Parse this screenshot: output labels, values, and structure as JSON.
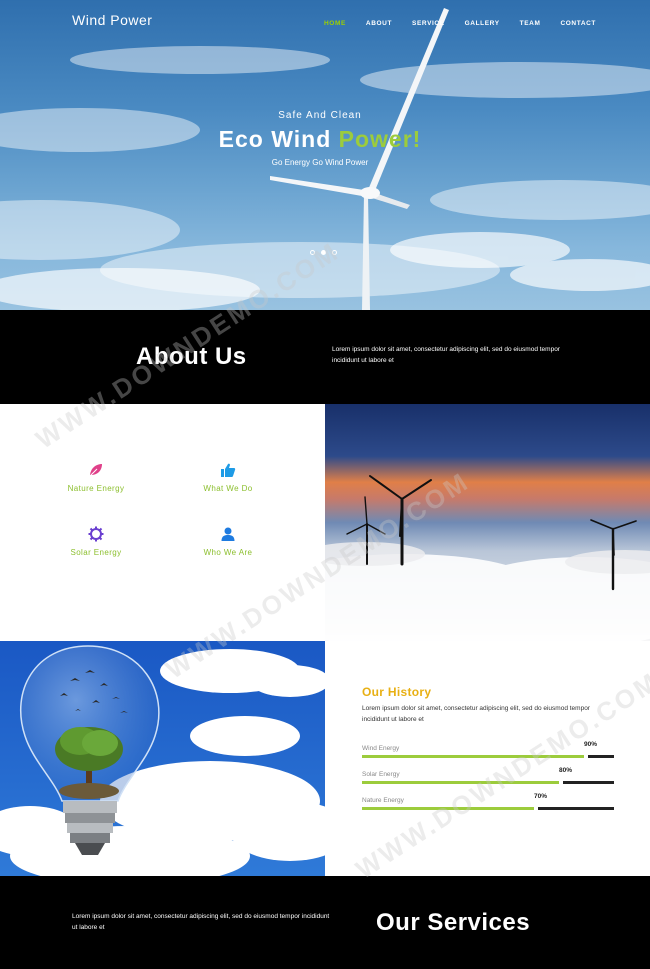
{
  "header": {
    "brand": "Wind Power",
    "nav": [
      {
        "label": "HOME",
        "active": true
      },
      {
        "label": "ABOUT",
        "active": false
      },
      {
        "label": "SERVICE",
        "active": false
      },
      {
        "label": "GALLERY",
        "active": false
      },
      {
        "label": "TEAM",
        "active": false
      },
      {
        "label": "CONTACT",
        "active": false
      }
    ]
  },
  "hero": {
    "subtitle": "Safe And Clean",
    "title_part1": "Eco Wind ",
    "title_accent": "Power!",
    "tagline": "Go Energy Go Wind Power",
    "slides": 3,
    "active_slide": 2
  },
  "about": {
    "title": "About Us",
    "text": "Lorem ipsum dolor sit amet, consectetur adipiscing elit, sed do eiusmod tempor incididunt ut labore et"
  },
  "features": [
    {
      "label": "Nature Energy",
      "icon": "leaf-icon"
    },
    {
      "label": "What We Do",
      "icon": "thumbs-up-icon"
    },
    {
      "label": "Solar Energy",
      "icon": "gear-icon"
    },
    {
      "label": "Who We Are",
      "icon": "user-icon"
    }
  ],
  "history": {
    "title": "Our History",
    "text": "Lorem ipsum dolor sit amet, consectetur adipiscing elit, sed do eiusmod tempor incididunt ut labore et",
    "skills": [
      {
        "name": "Wind Energy",
        "percent": "90%",
        "value": 90
      },
      {
        "name": "Solar Energy",
        "percent": "80%",
        "value": 80
      },
      {
        "name": "Nature Energy",
        "percent": "70%",
        "value": 70
      }
    ]
  },
  "services": {
    "title": "Our Services",
    "text": "Lorem ipsum dolor sit amet, consectetur adipiscing elit, sed do eiusmod tempor incididunt ut labore et"
  },
  "watermark": "WWW.DOWNDEMO.COM",
  "colors": {
    "accent_green": "#9ccc3c",
    "history_title": "#e8b014",
    "feature_label": "#8cbf2e",
    "leaf_icon": "#e0418a",
    "thumbs_icon": "#1e9be6",
    "gear_icon": "#6a3fd0",
    "user_icon": "#1e7be0"
  }
}
